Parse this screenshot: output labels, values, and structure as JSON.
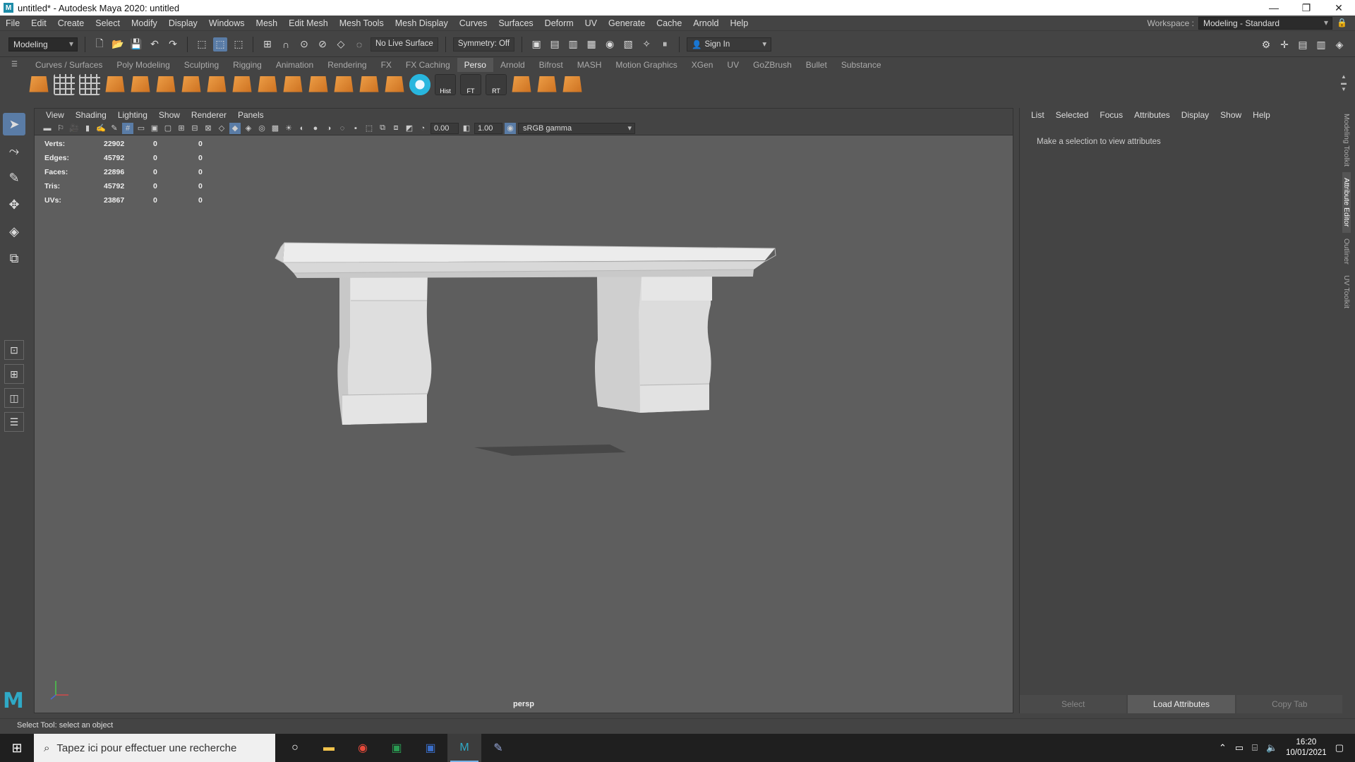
{
  "window": {
    "title": "untitled* - Autodesk Maya 2020: untitled",
    "app_icon": "M"
  },
  "menubar": {
    "items": [
      "File",
      "Edit",
      "Create",
      "Select",
      "Modify",
      "Display",
      "Windows",
      "Mesh",
      "Edit Mesh",
      "Mesh Tools",
      "Mesh Display",
      "Curves",
      "Surfaces",
      "Deform",
      "UV",
      "Generate",
      "Cache",
      "Arnold",
      "Help"
    ],
    "workspace_label": "Workspace :",
    "workspace_value": "Modeling - Standard"
  },
  "statusline": {
    "mode": "Modeling",
    "live_surface": "No Live Surface",
    "symmetry": "Symmetry: Off",
    "sign_in": "Sign In"
  },
  "shelf": {
    "tabs": [
      "Curves / Surfaces",
      "Poly Modeling",
      "Sculpting",
      "Rigging",
      "Animation",
      "Rendering",
      "FX",
      "FX Caching",
      "Perso",
      "Arnold",
      "Bifrost",
      "MASH",
      "Motion Graphics",
      "XGen",
      "UV",
      "GoZBrush",
      "Bullet",
      "Substance"
    ],
    "active_tab": "Perso",
    "labeled_icons": [
      "Hist",
      "FT",
      "RT"
    ]
  },
  "viewport": {
    "menu": [
      "View",
      "Shading",
      "Lighting",
      "Show",
      "Renderer",
      "Panels"
    ],
    "exposure": "0.00",
    "gamma": "1.00",
    "color_space": "sRGB gamma",
    "camera": "persp",
    "hud": [
      {
        "label": "Verts:",
        "v1": "22902",
        "v2": "0",
        "v3": "0"
      },
      {
        "label": "Edges:",
        "v1": "45792",
        "v2": "0",
        "v3": "0"
      },
      {
        "label": "Faces:",
        "v1": "22896",
        "v2": "0",
        "v3": "0"
      },
      {
        "label": "Tris:",
        "v1": "45792",
        "v2": "0",
        "v3": "0"
      },
      {
        "label": "UVs:",
        "v1": "23867",
        "v2": "0",
        "v3": "0"
      }
    ]
  },
  "attribute_editor": {
    "menu": [
      "List",
      "Selected",
      "Focus",
      "Attributes",
      "Display",
      "Show",
      "Help"
    ],
    "message": "Make a selection to view attributes",
    "buttons": {
      "select": "Select",
      "load": "Load Attributes",
      "copy": "Copy Tab"
    }
  },
  "side_tabs": [
    "Modeling Toolkit",
    "Attribute Editor",
    "Outliner",
    "UV Toolkit"
  ],
  "helpline": "Select Tool: select an object",
  "taskbar": {
    "search_placeholder": "Tapez ici pour effectuer une recherche",
    "time": "16:20",
    "date": "10/01/2021"
  },
  "colors": {
    "accent": "#5a7ca6",
    "viewport_bg": "#5e5e5e",
    "ui_bg": "#444444",
    "maya_teal": "#2fa9c6"
  }
}
